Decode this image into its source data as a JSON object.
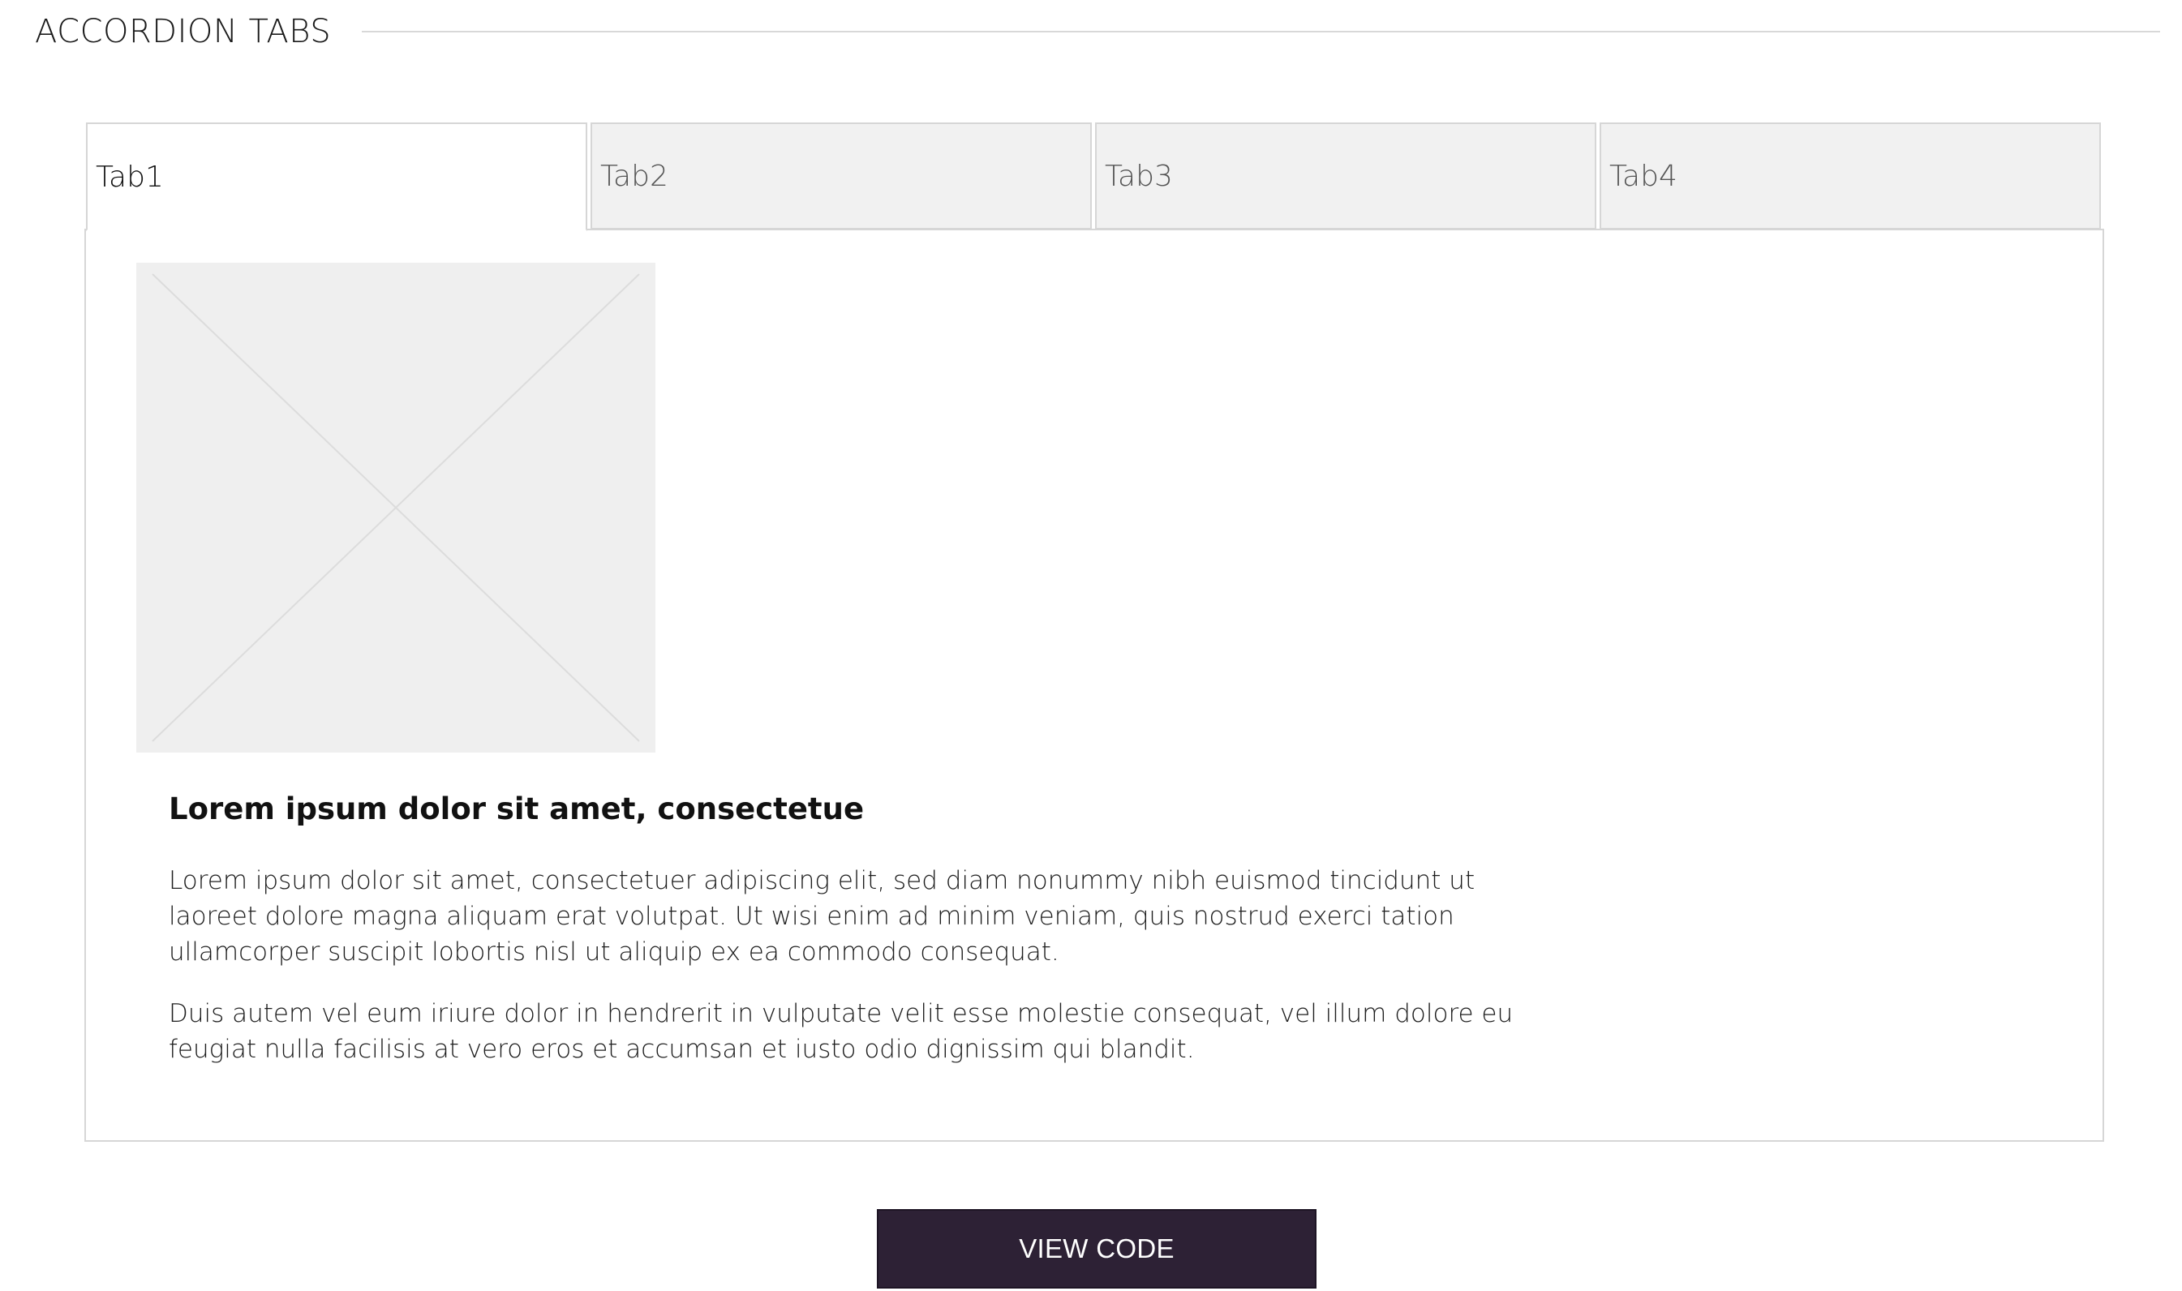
{
  "section": {
    "title": "ACCORDION TABS"
  },
  "tabs": [
    {
      "label": "Tab1",
      "active": true
    },
    {
      "label": "Tab2",
      "active": false
    },
    {
      "label": "Tab3",
      "active": false
    },
    {
      "label": "Tab4",
      "active": false
    }
  ],
  "panel": {
    "image_icon": "image-placeholder-icon",
    "heading": "Lorem ipsum dolor sit amet, consectetue",
    "paragraphs": [
      "Lorem ipsum dolor sit amet, consectetuer adipiscing elit, sed diam nonummy nibh euismod tincidunt ut laoreet dolore magna aliquam erat volutpat. Ut wisi enim ad minim veniam, quis nostrud exerci tation ullamcorper suscipit lobortis nisl ut aliquip ex ea commodo consequat.",
      "Duis autem vel eum iriure dolor in hendrerit in vulputate velit esse molestie consequat, vel illum dolore eu feugiat nulla facilisis at vero eros et accumsan et iusto odio dignissim qui blandit."
    ]
  },
  "button": {
    "label": "VIEW CODE",
    "color": "#2d2135"
  }
}
